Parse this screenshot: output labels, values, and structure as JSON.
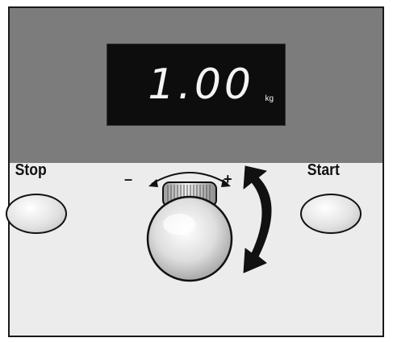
{
  "display": {
    "readout": "1.00",
    "unit": "kg"
  },
  "buttons": {
    "stop_label": "Stop",
    "start_label": "Start"
  },
  "knob": {
    "minus": "–",
    "plus": "+"
  },
  "colors": {
    "panel_upper": "#7c7c7c",
    "panel_lower": "#ececec",
    "display_bg": "#0d0d0d",
    "display_text": "#f4f4f4"
  }
}
